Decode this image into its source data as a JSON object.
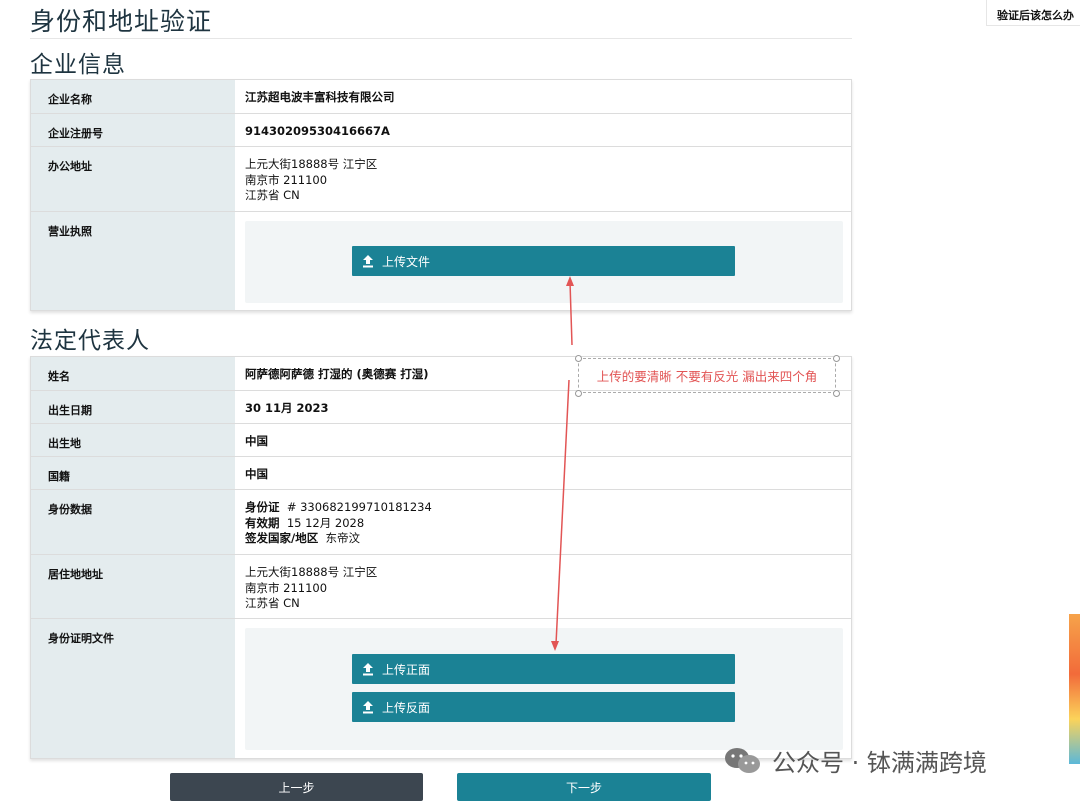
{
  "page": {
    "title": "身份和地址验证",
    "help_link": "验证后该怎么办"
  },
  "company": {
    "section_title": "企业信息",
    "rows": [
      {
        "label": "企业名称",
        "value": "江苏超电波丰富科技有限公司"
      },
      {
        "label": "企业注册号",
        "value": "91430209530416667A"
      },
      {
        "label": "办公地址",
        "lines": [
          "上元大街18888号 江宁区",
          "南京市 211100",
          "江苏省 CN"
        ]
      },
      {
        "label": "营业执照"
      }
    ],
    "upload_button": "上传文件"
  },
  "legal_rep": {
    "section_title": "法定代表人",
    "rows": [
      {
        "label": "姓名",
        "value": "阿萨德阿萨德 打湿的 (奥德赛 打湿)"
      },
      {
        "label": "出生日期",
        "value": "30 11月 2023"
      },
      {
        "label": "出生地",
        "value": "中国"
      },
      {
        "label": "国籍",
        "value": "中国"
      },
      {
        "label": "身份数据",
        "id_label": "身份证",
        "id_value": "# 330682199710181234",
        "expiry_label": "有效期",
        "expiry_value": "15 12月 2028",
        "country_label": "签发国家/地区",
        "country_value": "东帝汶"
      },
      {
        "label": "居住地地址",
        "lines": [
          "上元大街18888号 江宁区",
          "南京市 211100",
          "江苏省 CN"
        ]
      },
      {
        "label": "身份证明文件"
      }
    ],
    "upload_front": "上传正面",
    "upload_back": "上传反面"
  },
  "nav": {
    "prev": "上一步",
    "next": "下一步"
  },
  "annotation": {
    "text": "上传的要清晰 不要有反光 漏出来四个角"
  },
  "watermark": {
    "text": "公众号 · 钵满满跨境"
  },
  "colors": {
    "accent": "#1b8295",
    "label_bg": "#e4ecee",
    "prev_btn": "#3c4650",
    "annotation": "#e25555"
  },
  "icons": {
    "upload": "upload-icon",
    "wechat": "wechat-icon"
  }
}
